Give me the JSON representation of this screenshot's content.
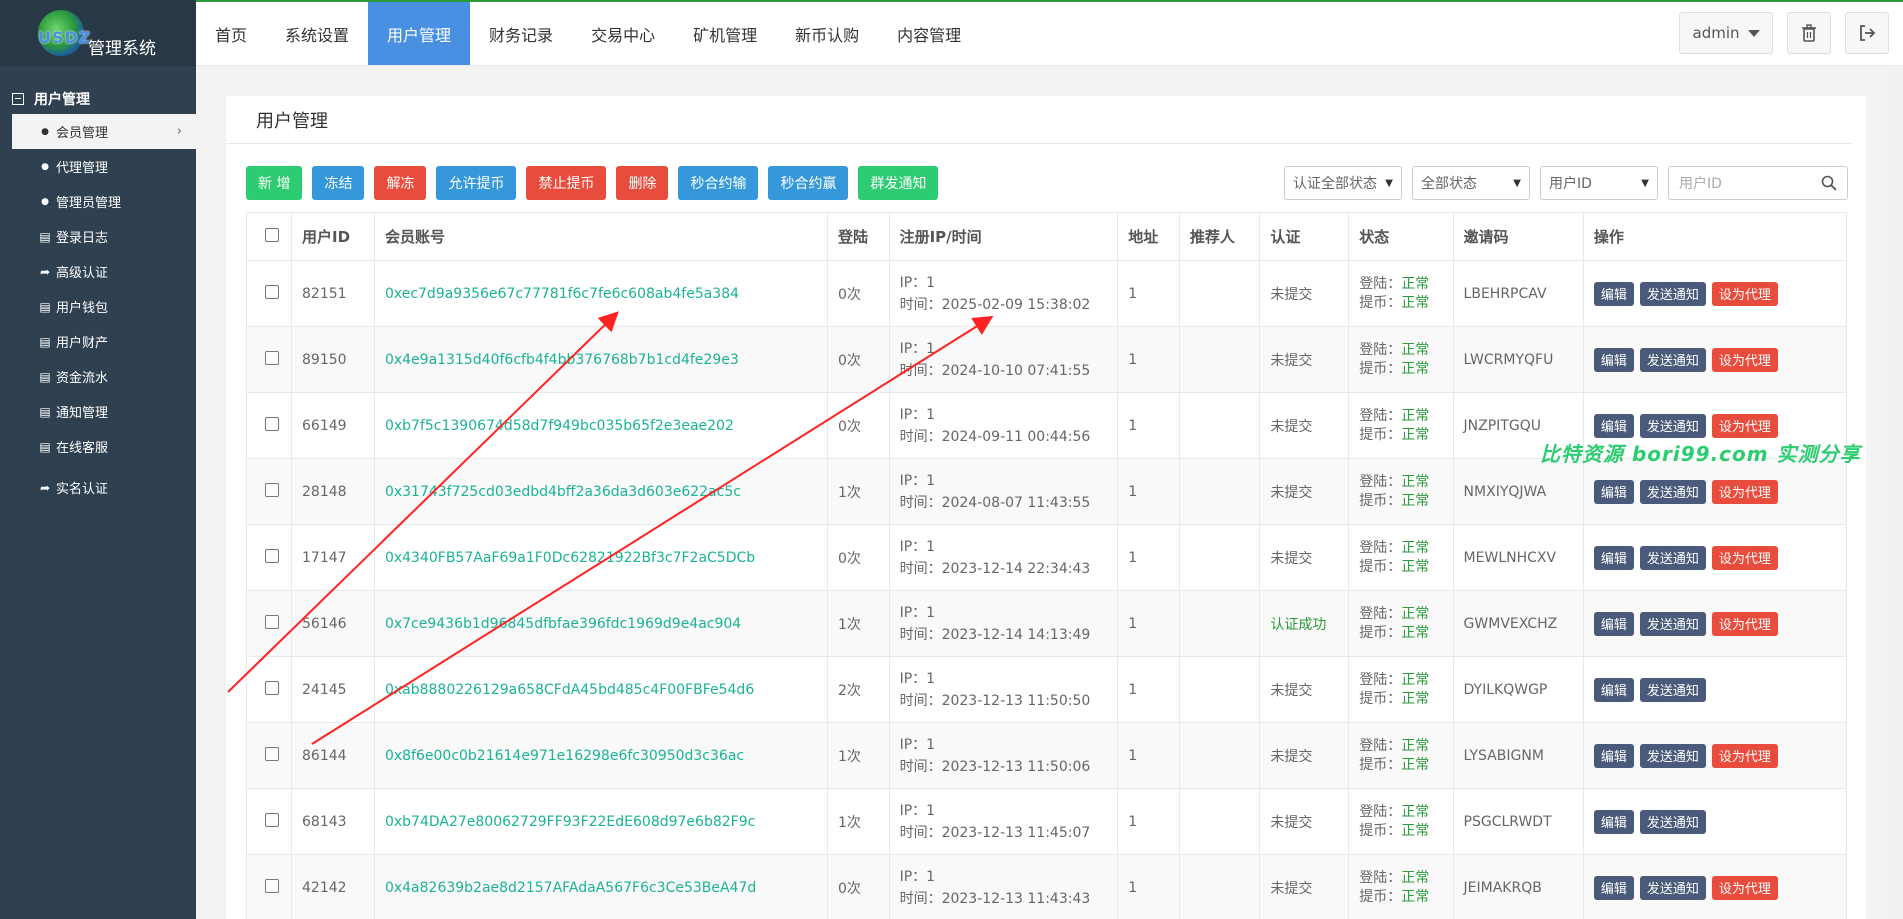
{
  "logo": {
    "brand": "USDZ",
    "system": "管理系统"
  },
  "sidebar": {
    "section": "用户管理",
    "items": [
      {
        "label": "会员管理",
        "icon": "user-icon"
      },
      {
        "label": "代理管理",
        "icon": "user-icon"
      },
      {
        "label": "管理员管理",
        "icon": "user-icon"
      },
      {
        "label": "登录日志",
        "icon": "list-icon"
      },
      {
        "label": "高级认证",
        "icon": "share-icon"
      },
      {
        "label": "用户钱包",
        "icon": "list-icon"
      },
      {
        "label": "用户财产",
        "icon": "list-icon"
      },
      {
        "label": "资金流水",
        "icon": "list-icon"
      },
      {
        "label": "通知管理",
        "icon": "list-icon"
      },
      {
        "label": "在线客服",
        "icon": "list-icon"
      },
      {
        "label": "实名认证",
        "icon": "share-icon"
      }
    ]
  },
  "topnav": {
    "tabs": [
      "首页",
      "系统设置",
      "用户管理",
      "财务记录",
      "交易中心",
      "矿机管理",
      "新币认购",
      "内容管理"
    ],
    "active": "用户管理",
    "user": "admin"
  },
  "panel": {
    "title": "用户管理"
  },
  "toolbar": {
    "buttons": [
      {
        "label": "新 增",
        "color": "green"
      },
      {
        "label": "冻结",
        "color": "blue"
      },
      {
        "label": "解冻",
        "color": "red"
      },
      {
        "label": "允许提币",
        "color": "blue"
      },
      {
        "label": "禁止提币",
        "color": "red"
      },
      {
        "label": "删除",
        "color": "red"
      },
      {
        "label": "秒合约输",
        "color": "blue"
      },
      {
        "label": "秒合约赢",
        "color": "blue"
      },
      {
        "label": "群发通知",
        "color": "green"
      }
    ]
  },
  "filters": {
    "auth_select": "认证全部状态",
    "status_select": "全部状态",
    "field_select": "用户ID",
    "search_placeholder": "用户ID"
  },
  "table": {
    "headers": [
      "用户ID",
      "会员账号",
      "登陆",
      "注册IP/时间",
      "地址",
      "推荐人",
      "认证",
      "状态",
      "邀请码",
      "操作"
    ],
    "ip_prefix": "IP：",
    "time_prefix": "时间：",
    "login_prefix": "登陆：",
    "withdraw_prefix": "提币：",
    "ops": {
      "edit": "编辑",
      "notify": "发送通知",
      "agent": "设为代理"
    },
    "rows": [
      {
        "id": "82151",
        "account": "0xec7d9a9356e67c77781f6c7fe6c608ab4fe5a384",
        "login": "0次",
        "ip": "1",
        "time": "2025-02-09 15:38:02",
        "addr": "1",
        "ref": "",
        "auth": "未提交",
        "login_status": "正常",
        "withdraw_status": "正常",
        "invite": "LBEHRPCAV",
        "agent": true
      },
      {
        "id": "89150",
        "account": "0x4e9a1315d40f6cfb4f4bb376768b7b1cd4fe29e3",
        "login": "0次",
        "ip": "1",
        "time": "2024-10-10 07:41:55",
        "addr": "1",
        "ref": "",
        "auth": "未提交",
        "login_status": "正常",
        "withdraw_status": "正常",
        "invite": "LWCRMYQFU",
        "agent": true
      },
      {
        "id": "66149",
        "account": "0xb7f5c1390674d58d7f949bc035b65f2e3eae202",
        "login": "0次",
        "ip": "1",
        "time": "2024-09-11 00:44:56",
        "addr": "1",
        "ref": "",
        "auth": "未提交",
        "login_status": "正常",
        "withdraw_status": "正常",
        "invite": "JNZPITGQU",
        "agent": true
      },
      {
        "id": "28148",
        "account": "0x31743f725cd03edbd4bff2a36da3d603e622ac5c",
        "login": "1次",
        "ip": "1",
        "time": "2024-08-07 11:43:55",
        "addr": "1",
        "ref": "",
        "auth": "未提交",
        "login_status": "正常",
        "withdraw_status": "正常",
        "invite": "NMXIYQJWA",
        "agent": true
      },
      {
        "id": "17147",
        "account": "0x4340FB57AaF69a1F0Dc62821922Bf3c7F2aC5DCb",
        "login": "0次",
        "ip": "1",
        "time": "2023-12-14 22:34:43",
        "addr": "1",
        "ref": "",
        "auth": "未提交",
        "login_status": "正常",
        "withdraw_status": "正常",
        "invite": "MEWLNHCXV",
        "agent": true
      },
      {
        "id": "56146",
        "account": "0x7ce9436b1d96845dfbfae396fdc1969d9e4ac904",
        "login": "1次",
        "ip": "1",
        "time": "2023-12-14 14:13:49",
        "addr": "1",
        "ref": "",
        "auth": "认证成功",
        "login_status": "正常",
        "withdraw_status": "正常",
        "invite": "GWMVEXCHZ",
        "agent": true
      },
      {
        "id": "24145",
        "account": "0xab8880226129a658CFdA45bd485c4F00FBFe54d6",
        "login": "2次",
        "ip": "1",
        "time": "2023-12-13 11:50:50",
        "addr": "1",
        "ref": "",
        "auth": "未提交",
        "login_status": "正常",
        "withdraw_status": "正常",
        "invite": "DYILKQWGP",
        "agent": false
      },
      {
        "id": "86144",
        "account": "0x8f6e00c0b21614e971e16298e6fc30950d3c36ac",
        "login": "1次",
        "ip": "1",
        "time": "2023-12-13 11:50:06",
        "addr": "1",
        "ref": "",
        "auth": "未提交",
        "login_status": "正常",
        "withdraw_status": "正常",
        "invite": "LYSABIGNM",
        "agent": true
      },
      {
        "id": "68143",
        "account": "0xb74DA27e80062729FF93F22EdE608d97e6b82F9c",
        "login": "1次",
        "ip": "1",
        "time": "2023-12-13 11:45:07",
        "addr": "1",
        "ref": "",
        "auth": "未提交",
        "login_status": "正常",
        "withdraw_status": "正常",
        "invite": "PSGCLRWDT",
        "agent": false
      },
      {
        "id": "42142",
        "account": "0x4a82639b2ae8d2157AFAdaA567F6c3Ce53BeA47d",
        "login": "0次",
        "ip": "1",
        "time": "2023-12-13 11:43:43",
        "addr": "1",
        "ref": "",
        "auth": "未提交",
        "login_status": "正常",
        "withdraw_status": "正常",
        "invite": "JEIMAKRQB",
        "agent": true
      }
    ]
  },
  "watermark": "比特资源 bori99.com 实测分享",
  "colors": {
    "accent": "#4a90e2",
    "sidebar": "#2f4050",
    "success": "#2ecc71",
    "danger": "#e74c3c",
    "arrow": "#ff2222"
  }
}
